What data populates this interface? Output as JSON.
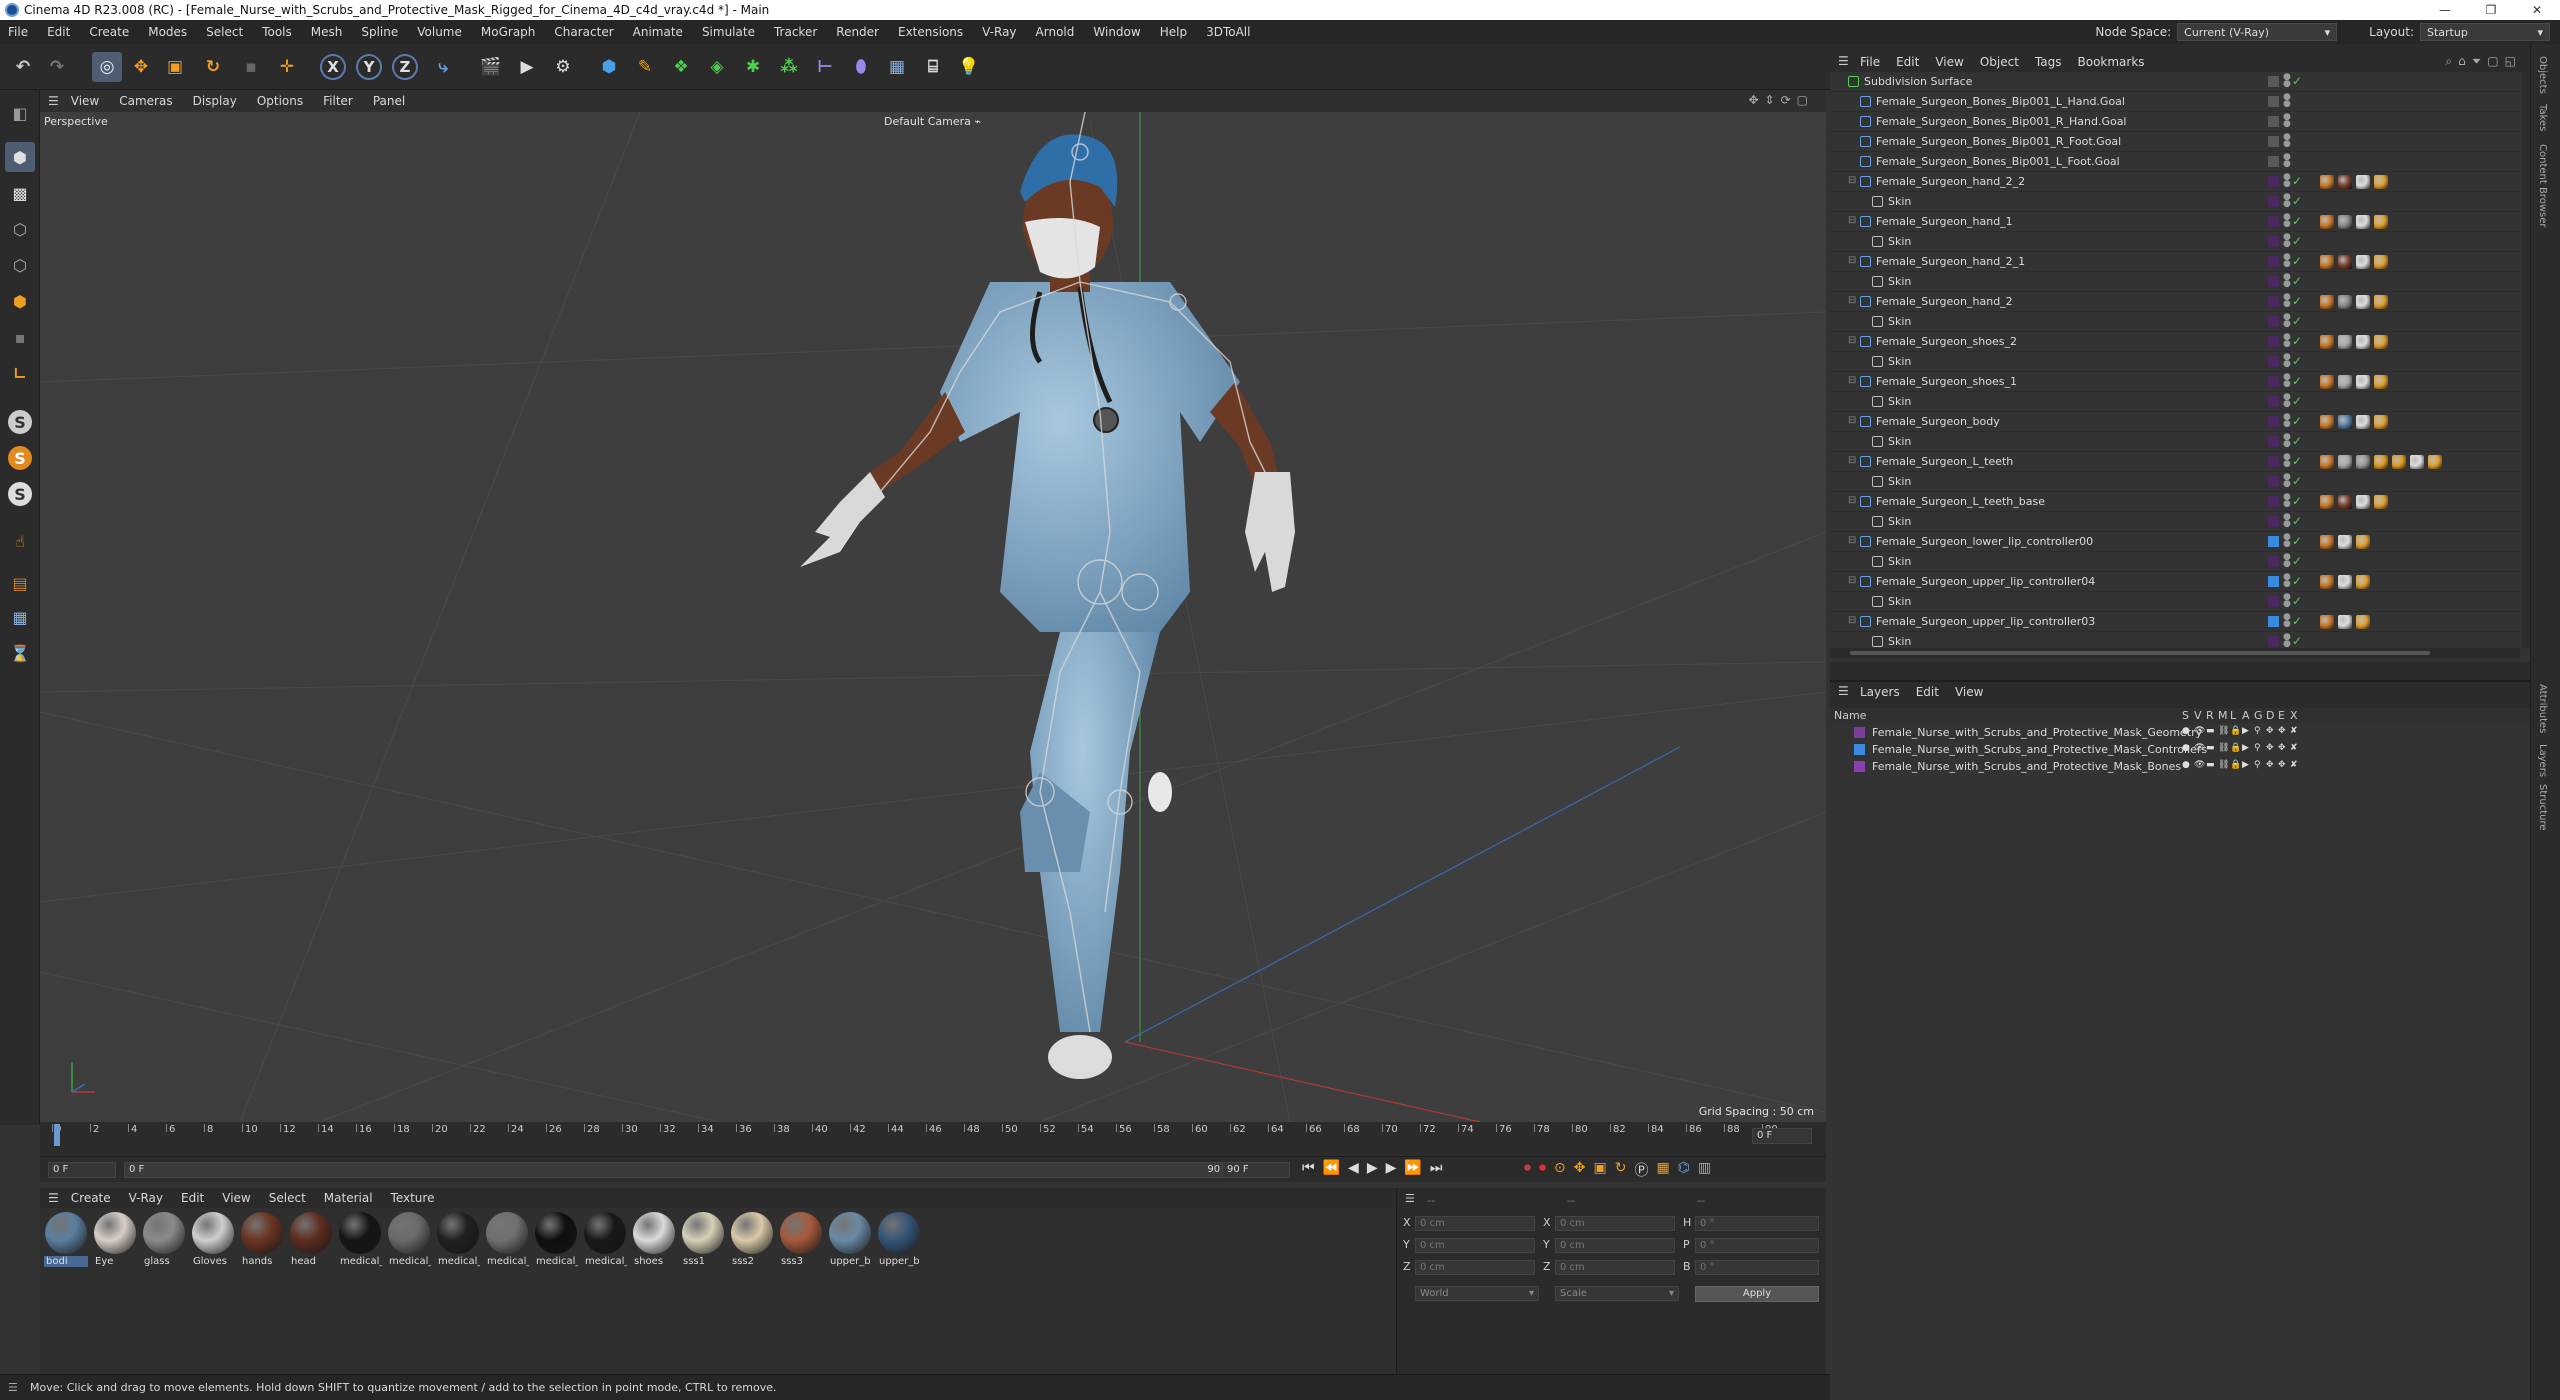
{
  "window": {
    "title": "Cinema 4D R23.008 (RC) - [Female_Nurse_with_Scrubs_and_Protective_Mask_Rigged_for_Cinema_4D_c4d_vray.c4d *] - Main",
    "controls": [
      "—",
      "❐",
      "✕"
    ]
  },
  "menubar": {
    "items": [
      "File",
      "Edit",
      "Create",
      "Modes",
      "Select",
      "Tools",
      "Mesh",
      "Spline",
      "Volume",
      "MoGraph",
      "Character",
      "Animate",
      "Simulate",
      "Tracker",
      "Render",
      "Extensions",
      "V-Ray",
      "Arnold",
      "Window",
      "Help",
      "3DToAll"
    ],
    "node_space_label": "Node Space:",
    "node_space_value": "Current (V-Ray)",
    "layout_label": "Layout:",
    "layout_value": "Startup"
  },
  "toolbar": {
    "axis_labels": [
      "X",
      "Y",
      "Z"
    ]
  },
  "lefttools": {
    "s_labels": [
      "S",
      "S",
      "S"
    ]
  },
  "viewport": {
    "menu": [
      "View",
      "Cameras",
      "Display",
      "Options",
      "Filter",
      "Panel"
    ],
    "projection": "Perspective",
    "camera": "Default Camera",
    "grid_spacing": "Grid Spacing : 50 cm"
  },
  "timeline": {
    "ticks": [
      "0",
      "2",
      "4",
      "6",
      "8",
      "10",
      "12",
      "14",
      "16",
      "18",
      "20",
      "22",
      "24",
      "26",
      "28",
      "30",
      "32",
      "34",
      "36",
      "38",
      "40",
      "42",
      "44",
      "46",
      "48",
      "50",
      "52",
      "54",
      "56",
      "58",
      "60",
      "62",
      "64",
      "66",
      "68",
      "70",
      "72",
      "74",
      "76",
      "78",
      "80",
      "82",
      "84",
      "86",
      "88",
      "90"
    ],
    "current_frame": "0 F",
    "start_field": "0 F",
    "slider_start": "0 F",
    "slider_end": "90 F",
    "end_field": "90 F"
  },
  "material_manager": {
    "menu": [
      "Create",
      "V-Ray",
      "Edit",
      "View",
      "Select",
      "Material",
      "Texture"
    ],
    "materials": [
      {
        "label": "bodi",
        "color": "#5a7fa0",
        "selected": true
      },
      {
        "label": "Eye",
        "color": "#d8cfc8"
      },
      {
        "label": "glass",
        "color": "#8b8b8b"
      },
      {
        "label": "Gloves",
        "color": "#cfcfcf"
      },
      {
        "label": "hands",
        "color": "#6a3422"
      },
      {
        "label": "head",
        "color": "#5e2d1e"
      },
      {
        "label": "medical_",
        "color": "#151515"
      },
      {
        "label": "medical_",
        "color": "#6a6a6a"
      },
      {
        "label": "medical_",
        "color": "#202020"
      },
      {
        "label": "medical_",
        "color": "#707070"
      },
      {
        "label": "medical_",
        "color": "#0f0f0f"
      },
      {
        "label": "medical_",
        "color": "#181818"
      },
      {
        "label": "shoes",
        "color": "#dadada"
      },
      {
        "label": "sss1",
        "color": "#d6d1b7"
      },
      {
        "label": "sss2",
        "color": "#d9caa8"
      },
      {
        "label": "sss3",
        "color": "#a65a3c"
      },
      {
        "label": "upper_b",
        "color": "#6a8aa6"
      },
      {
        "label": "upper_b",
        "color": "#355578"
      }
    ]
  },
  "coordinates": {
    "pos_labels": [
      "X",
      "Y",
      "Z"
    ],
    "size_labels": [
      "X",
      "Y",
      "Z"
    ],
    "rot_labels": [
      "H",
      "P",
      "B"
    ],
    "pos_values": [
      "0 cm",
      "0 cm",
      "0 cm"
    ],
    "size_values": [
      "0 cm",
      "0 cm",
      "0 cm"
    ],
    "rot_values": [
      "0 °",
      "0 °",
      "0 °"
    ],
    "mode": "World",
    "scale_mode": "Scale",
    "apply_label": "Apply",
    "header_dashes": [
      "--",
      "--",
      "--"
    ]
  },
  "status": "Move: Click and drag to move elements. Hold down SHIFT to quantize movement / add to the selection in point mode, CTRL to remove.",
  "object_manager": {
    "menu": [
      "File",
      "Edit",
      "View",
      "Object",
      "Tags",
      "Bookmarks"
    ],
    "rows": [
      {
        "name": "Subdivision Surface",
        "indent": 0,
        "kind": "subd",
        "tags": []
      },
      {
        "name": "Female_Surgeon_Bones_Bip001_L_Hand.Goal",
        "indent": 1,
        "kind": "null",
        "tags": []
      },
      {
        "name": "Female_Surgeon_Bones_Bip001_R_Hand.Goal",
        "indent": 1,
        "kind": "null",
        "tags": []
      },
      {
        "name": "Female_Surgeon_Bones_Bip001_R_Foot.Goal",
        "indent": 1,
        "kind": "null",
        "tags": []
      },
      {
        "name": "Female_Surgeon_Bones_Bip001_L_Foot.Goal",
        "indent": 1,
        "kind": "null",
        "tags": []
      },
      {
        "name": "Female_Surgeon_hand_2_2",
        "indent": 1,
        "kind": "mesh",
        "tags": [
          "#c87a2a",
          "#7a4030",
          "#ddd",
          "#e0a030"
        ]
      },
      {
        "name": "Skin",
        "indent": 2,
        "kind": "skin",
        "tags": []
      },
      {
        "name": "Female_Surgeon_hand_1",
        "indent": 1,
        "kind": "mesh",
        "tags": [
          "#c87a2a",
          "#888",
          "#ddd",
          "#e0a030"
        ]
      },
      {
        "name": "Skin",
        "indent": 2,
        "kind": "skin",
        "tags": []
      },
      {
        "name": "Female_Surgeon_hand_2_1",
        "indent": 1,
        "kind": "mesh",
        "tags": [
          "#c87a2a",
          "#7a4030",
          "#ddd",
          "#e0a030"
        ]
      },
      {
        "name": "Skin",
        "indent": 2,
        "kind": "skin",
        "tags": []
      },
      {
        "name": "Female_Surgeon_hand_2",
        "indent": 1,
        "kind": "mesh",
        "tags": [
          "#c87a2a",
          "#888",
          "#ddd",
          "#e0a030"
        ]
      },
      {
        "name": "Skin",
        "indent": 2,
        "kind": "skin",
        "tags": []
      },
      {
        "name": "Female_Surgeon_shoes_2",
        "indent": 1,
        "kind": "mesh",
        "tags": [
          "#c87a2a",
          "#aaa",
          "#ddd",
          "#e0a030"
        ]
      },
      {
        "name": "Skin",
        "indent": 2,
        "kind": "skin",
        "tags": []
      },
      {
        "name": "Female_Surgeon_shoes_1",
        "indent": 1,
        "kind": "mesh",
        "tags": [
          "#c87a2a",
          "#aaa",
          "#ddd",
          "#e0a030"
        ]
      },
      {
        "name": "Skin",
        "indent": 2,
        "kind": "skin",
        "tags": []
      },
      {
        "name": "Female_Surgeon_body",
        "indent": 1,
        "kind": "mesh",
        "tags": [
          "#c87a2a",
          "#5a7fa0",
          "#ddd",
          "#e0a030"
        ]
      },
      {
        "name": "Skin",
        "indent": 2,
        "kind": "skin",
        "tags": []
      },
      {
        "name": "Female_Surgeon_L_teeth",
        "indent": 1,
        "kind": "mesh",
        "tags": [
          "#c87a2a",
          "#aaa",
          "#999",
          "#e09a20",
          "#e09a20",
          "#ddd",
          "#e0a030"
        ]
      },
      {
        "name": "Skin",
        "indent": 2,
        "kind": "skin",
        "tags": []
      },
      {
        "name": "Female_Surgeon_L_teeth_base",
        "indent": 1,
        "kind": "mesh",
        "tags": [
          "#c87a2a",
          "#7a4030",
          "#ddd",
          "#e0a030"
        ]
      },
      {
        "name": "Skin",
        "indent": 2,
        "kind": "skin",
        "tags": []
      },
      {
        "name": "Female_Surgeon_lower_lip_controller00",
        "indent": 1,
        "kind": "mesh",
        "swatch": "#3a8ae0",
        "tags": [
          "#c87a2a",
          "#ddd",
          "#e0a030"
        ]
      },
      {
        "name": "Skin",
        "indent": 2,
        "kind": "skin",
        "tags": []
      },
      {
        "name": "Female_Surgeon_upper_lip_controller04",
        "indent": 1,
        "kind": "mesh",
        "swatch": "#3a8ae0",
        "tags": [
          "#c87a2a",
          "#ddd",
          "#e0a030"
        ]
      },
      {
        "name": "Skin",
        "indent": 2,
        "kind": "skin",
        "tags": []
      },
      {
        "name": "Female_Surgeon_upper_lip_controller03",
        "indent": 1,
        "kind": "mesh",
        "swatch": "#3a8ae0",
        "tags": [
          "#c87a2a",
          "#ddd",
          "#e0a030"
        ]
      },
      {
        "name": "Skin",
        "indent": 2,
        "kind": "skin",
        "tags": []
      }
    ]
  },
  "layer_manager": {
    "menu": [
      "Layers",
      "Edit",
      "View"
    ],
    "columns": [
      "Name",
      "S",
      "V",
      "R",
      "M",
      "L",
      "A",
      "G",
      "D",
      "E",
      "X"
    ],
    "layers": [
      {
        "name": "Female_Nurse_with_Scrubs_and_Protective_Mask_Geometry",
        "color": "#7a3f9a"
      },
      {
        "name": "Female_Nurse_with_Scrubs_and_Protective_Mask_Controllers",
        "color": "#3a8ae0"
      },
      {
        "name": "Female_Nurse_with_Scrubs_and_Protective_Mask_Bones",
        "color": "#8a3fae"
      }
    ]
  },
  "side_tabs": [
    "Objects",
    "Takes",
    "Content Browser",
    "Attributes",
    "Layers",
    "Structure"
  ]
}
